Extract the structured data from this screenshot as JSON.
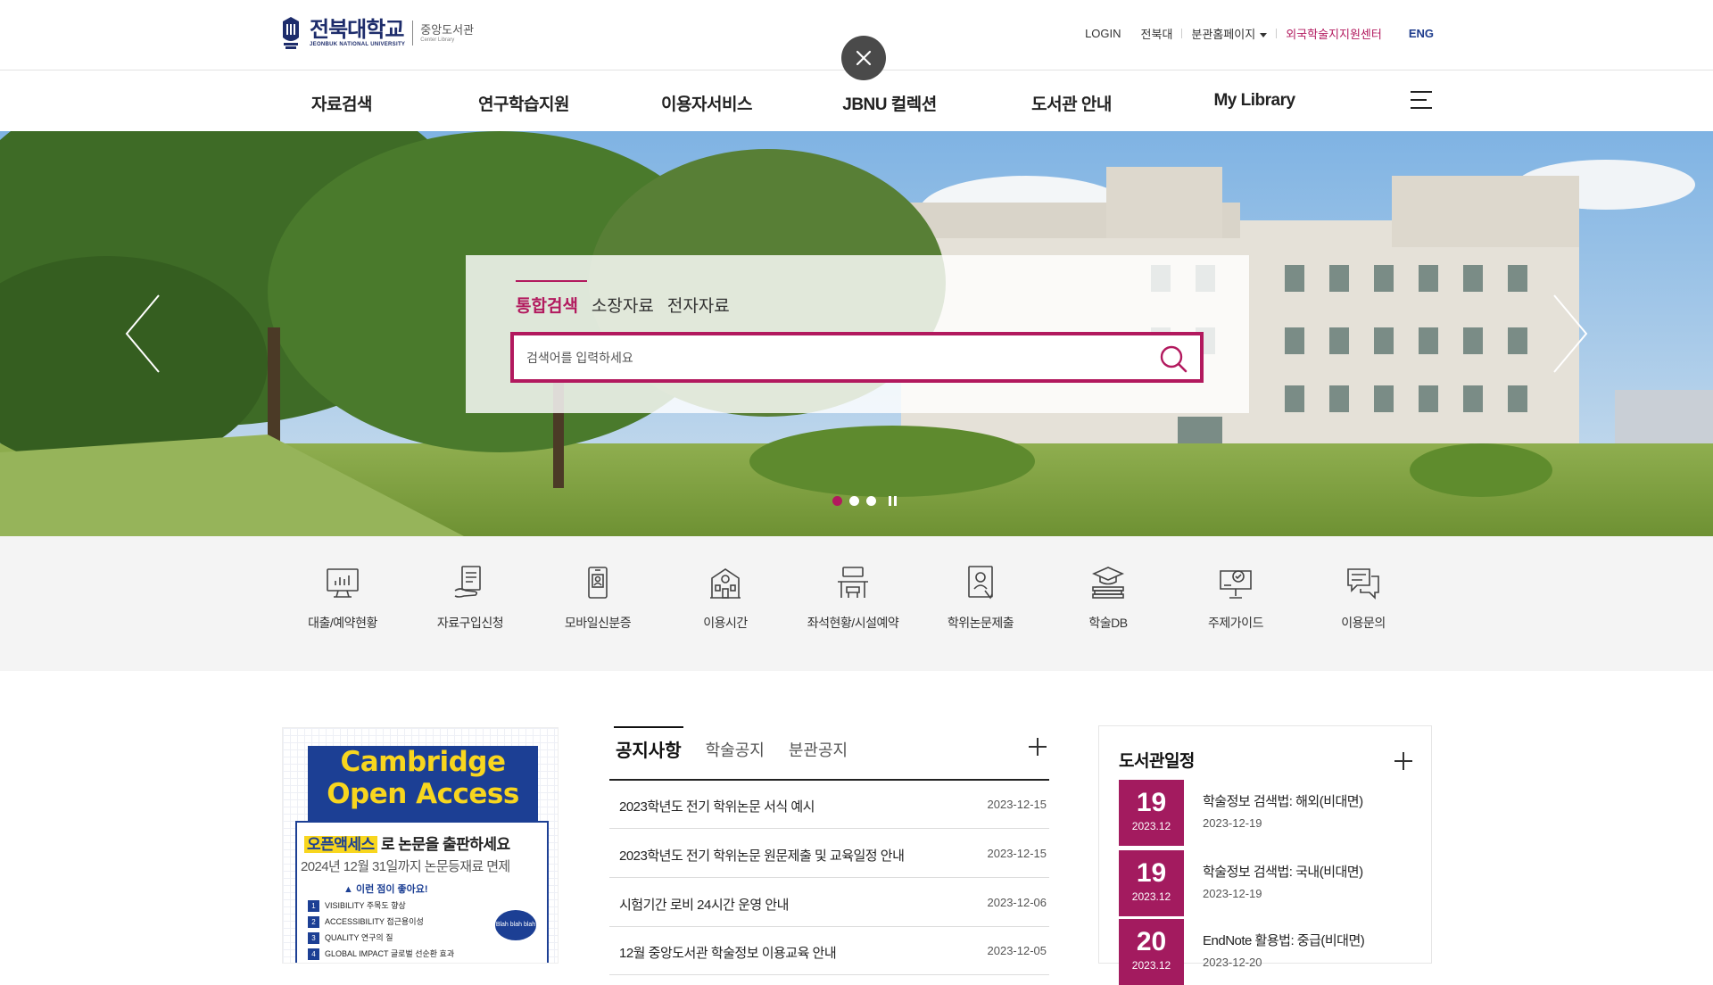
{
  "header": {
    "logo_name": "전북대학교",
    "logo_eng": "JEONBUK NATIONAL UNIVERSITY",
    "logo_sub": "중앙도서관",
    "logo_sub_en": "Center Library",
    "util": {
      "login": "LOGIN",
      "jbnu": "전북대",
      "branch": "분관홈페이지",
      "foreign": "외국학술지지원센터",
      "eng": "ENG"
    }
  },
  "nav": {
    "items": [
      "자료검색",
      "연구학습지원",
      "이용자서비스",
      "JBNU 컬렉션",
      "도서관 안내",
      "My Library"
    ]
  },
  "hero": {
    "tabs": [
      "통합검색",
      "소장자료",
      "전자자료"
    ],
    "active_tab": "통합검색",
    "search_placeholder": "검색어를 입력하세요",
    "slide_count": 3,
    "active_slide": 1
  },
  "quick": [
    {
      "label": "대출/예약현황",
      "icon": "monitor-chart-icon"
    },
    {
      "label": "자료구입신청",
      "icon": "document-hand-icon"
    },
    {
      "label": "모바일신분증",
      "icon": "mobile-id-icon"
    },
    {
      "label": "이용시간",
      "icon": "building-icon"
    },
    {
      "label": "좌석현황/시설예약",
      "icon": "desk-chair-icon"
    },
    {
      "label": "학위논문제출",
      "icon": "thesis-icon"
    },
    {
      "label": "학술DB",
      "icon": "graduation-books-icon"
    },
    {
      "label": "주제가이드",
      "icon": "presentation-guide-icon"
    },
    {
      "label": "이용문의",
      "icon": "chat-bubbles-icon"
    }
  ],
  "banner": {
    "title_line1": "Cambridge",
    "title_line2": "Open Access",
    "highlight": "오픈액세스",
    "subtitle_rest": "로 논문을 출판하세요",
    "deadline": "2024년 12월 31일까지 논문등재료 면제",
    "good_points": "이런 점이 좋아요!",
    "points": [
      "VISIBILITY 주목도 향상",
      "ACCESSIBILITY 접근용이성",
      "QUALITY 연구의 질",
      "GLOBAL IMPACT 글로벌 선순환 효과"
    ],
    "bubble": "Blah blah blah"
  },
  "notice": {
    "tabs": [
      "공지사항",
      "학술공지",
      "분관공지"
    ],
    "active_tab": "공지사항",
    "rows": [
      {
        "title": "2023학년도 전기 학위논문 서식 예시",
        "date": "2023-12-15"
      },
      {
        "title": "2023학년도 전기 학위논문 원문제출 및 교육일정 안내",
        "date": "2023-12-15"
      },
      {
        "title": "시험기간 로비 24시간 운영 안내",
        "date": "2023-12-06"
      },
      {
        "title": "12월 중앙도서관 학술정보 이용교육 안내",
        "date": "2023-12-05"
      }
    ]
  },
  "schedule": {
    "title": "도서관일정",
    "items": [
      {
        "day": "19",
        "ym": "2023.12",
        "name": "학술정보 검색법: 해외(비대면)",
        "date": "2023-12-19"
      },
      {
        "day": "19",
        "ym": "2023.12",
        "name": "학술정보 검색법: 국내(비대면)",
        "date": "2023-12-19"
      },
      {
        "day": "20",
        "ym": "2023.12",
        "name": "EndNote 활용법: 중급(비대면)",
        "date": "2023-12-20"
      }
    ]
  },
  "colors": {
    "accent": "#b2195e",
    "navy": "#1d2c6b",
    "schedule_date": "#a31b5f",
    "banner_blue": "#1c3f94",
    "banner_yellow": "#f8d61e"
  }
}
